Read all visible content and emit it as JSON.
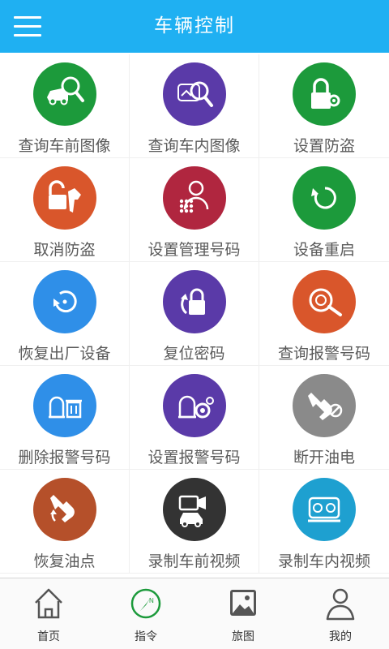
{
  "header": {
    "title": "车辆控制",
    "menu_icon": "menu-icon"
  },
  "colors": {
    "header": "#1fb0f2",
    "green": "#1c9a3b",
    "purple": "#5a3aa8",
    "orange": "#d9562b",
    "crimson": "#b0263f",
    "blue": "#2f8fe8",
    "gray": "#8a8a8a",
    "brown": "#b5502a",
    "dark": "#333333",
    "teal": "#1ea0d0"
  },
  "grid": [
    {
      "label": "查询车前图像",
      "icon": "car-search-icon"
    },
    {
      "label": "查询车内图像",
      "icon": "interior-search-icon"
    },
    {
      "label": "设置防盗",
      "icon": "lock-gear-icon"
    },
    {
      "label": "取消防盗",
      "icon": "unlock-key-icon"
    },
    {
      "label": "设置管理号码",
      "icon": "user-keypad-icon"
    },
    {
      "label": "设备重启",
      "icon": "restart-icon"
    },
    {
      "label": "恢复出厂设备",
      "icon": "factory-reset-icon"
    },
    {
      "label": "复位密码",
      "icon": "reset-lock-icon"
    },
    {
      "label": "查询报警号码",
      "icon": "alarm-search-icon"
    },
    {
      "label": "删除报警号码",
      "icon": "delete-alarm-icon"
    },
    {
      "label": "设置报警号码",
      "icon": "alarm-settings-icon"
    },
    {
      "label": "断开油电",
      "icon": "fuel-cut-icon"
    },
    {
      "label": "恢复油点",
      "icon": "fuel-restore-icon"
    },
    {
      "label": "录制车前视频",
      "icon": "front-video-icon"
    },
    {
      "label": "录制车内视频",
      "icon": "interior-video-icon"
    }
  ],
  "tabs": [
    {
      "label": "首页",
      "icon": "home-icon"
    },
    {
      "label": "指令",
      "icon": "compass-icon"
    },
    {
      "label": "旅图",
      "icon": "picture-icon"
    },
    {
      "label": "我的",
      "icon": "person-icon"
    }
  ]
}
